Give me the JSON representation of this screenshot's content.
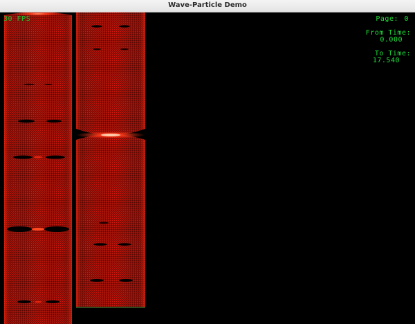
{
  "window": {
    "title": "Wave-Particle Demo"
  },
  "hud": {
    "fps": "30 FPS",
    "page_label": "Page:",
    "page_value": "0",
    "from_label": "From Time:",
    "from_value": "0.000",
    "to_label": "To Time:",
    "to_value": "17.540"
  },
  "colors": {
    "background": "#000000",
    "wave": "#b01208",
    "wave_bright": "#ff3a1a",
    "hud_text": "#1fe23b",
    "baseline": "#2f8f3a"
  },
  "panels": [
    {
      "name": "left-wave-column",
      "node_fractions": [
        0.0,
        0.24,
        0.36,
        0.58,
        0.73,
        1.0
      ],
      "strong_node_fraction": 0.73
    },
    {
      "name": "right-wave-column",
      "node_fractions": [
        0.0,
        0.04,
        0.13,
        0.4,
        0.7,
        0.77,
        0.9
      ],
      "strong_node_fraction": 0.4
    }
  ]
}
